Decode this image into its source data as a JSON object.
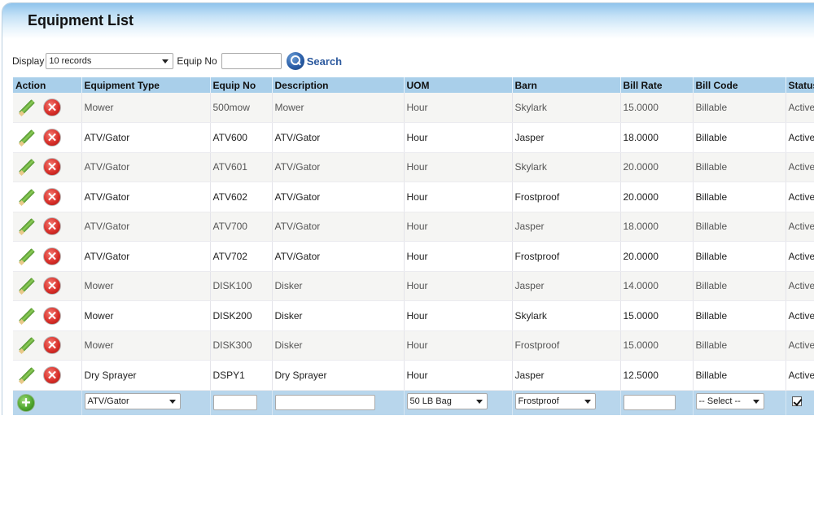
{
  "page": {
    "title": "Equipment List"
  },
  "filters": {
    "display_label": "Display",
    "display_value": "10 records",
    "equip_no_label": "Equip No",
    "equip_no_value": "",
    "search_label": "Search",
    "search_icon": "magnifier-icon"
  },
  "table": {
    "columns": [
      "Action",
      "Equipment Type",
      "Equip No",
      "Description",
      "UOM",
      "Barn",
      "Bill Rate",
      "Bill Code",
      "Status"
    ],
    "rows": [
      {
        "type": "Mower",
        "equip_no": "500mow",
        "description": "Mower",
        "uom": "Hour",
        "barn": "Skylark",
        "bill_rate": "15.0000",
        "bill_code": "Billable",
        "status": "Active"
      },
      {
        "type": "ATV/Gator",
        "equip_no": "ATV600",
        "description": "ATV/Gator",
        "uom": "Hour",
        "barn": "Jasper",
        "bill_rate": "18.0000",
        "bill_code": "Billable",
        "status": "Active"
      },
      {
        "type": "ATV/Gator",
        "equip_no": "ATV601",
        "description": "ATV/Gator",
        "uom": "Hour",
        "barn": "Skylark",
        "bill_rate": "20.0000",
        "bill_code": "Billable",
        "status": "Active"
      },
      {
        "type": "ATV/Gator",
        "equip_no": "ATV602",
        "description": "ATV/Gator",
        "uom": "Hour",
        "barn": "Frostproof",
        "bill_rate": "20.0000",
        "bill_code": "Billable",
        "status": "Active"
      },
      {
        "type": "ATV/Gator",
        "equip_no": "ATV700",
        "description": "ATV/Gator",
        "uom": "Hour",
        "barn": "Jasper",
        "bill_rate": "18.0000",
        "bill_code": "Billable",
        "status": "Active"
      },
      {
        "type": "ATV/Gator",
        "equip_no": "ATV702",
        "description": "ATV/Gator",
        "uom": "Hour",
        "barn": "Frostproof",
        "bill_rate": "20.0000",
        "bill_code": "Billable",
        "status": "Active"
      },
      {
        "type": "Mower",
        "equip_no": "DISK100",
        "description": "Disker",
        "uom": "Hour",
        "barn": "Jasper",
        "bill_rate": "14.0000",
        "bill_code": "Billable",
        "status": "Active"
      },
      {
        "type": "Mower",
        "equip_no": "DISK200",
        "description": "Disker",
        "uom": "Hour",
        "barn": "Skylark",
        "bill_rate": "15.0000",
        "bill_code": "Billable",
        "status": "Active"
      },
      {
        "type": "Mower",
        "equip_no": "DISK300",
        "description": "Disker",
        "uom": "Hour",
        "barn": "Frostproof",
        "bill_rate": "15.0000",
        "bill_code": "Billable",
        "status": "Active"
      },
      {
        "type": "Dry Sprayer",
        "equip_no": "DSPY1",
        "description": "Dry Sprayer",
        "uom": "Hour",
        "barn": "Jasper",
        "bill_rate": "12.5000",
        "bill_code": "Billable",
        "status": "Active"
      }
    ],
    "new_row": {
      "type_value": "ATV/Gator",
      "equip_no_value": "",
      "description_value": "",
      "uom_value": "50 LB  Bag",
      "barn_value": "Frostproof",
      "bill_rate_value": "",
      "bill_code_value": "-- Select --",
      "active_checked": true
    },
    "icons": {
      "edit": "pencil-icon",
      "delete": "delete-x-icon",
      "add": "plus-icon"
    },
    "delete_glyph": "✕",
    "add_glyph": "+"
  }
}
